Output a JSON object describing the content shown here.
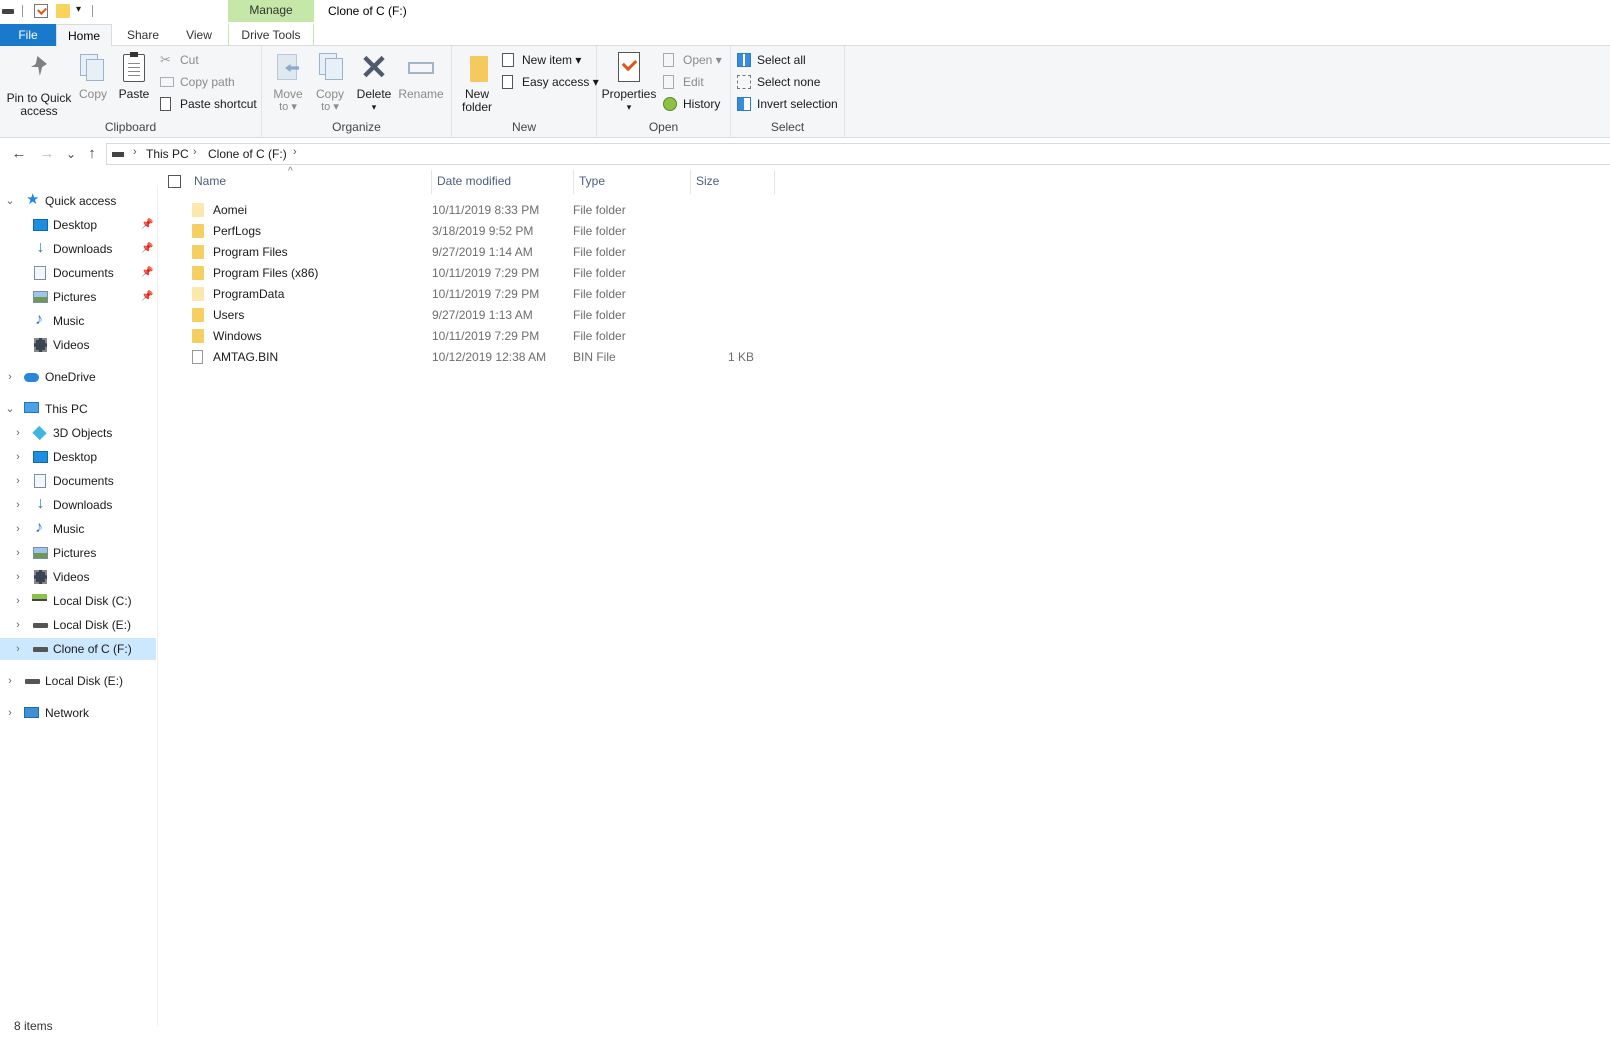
{
  "window": {
    "title": "Clone of C (F:)",
    "context_tab_header": "Manage",
    "qat_dropdown": "▾"
  },
  "tabs": {
    "file": "File",
    "home": "Home",
    "share": "Share",
    "view": "View",
    "drive_tools": "Drive Tools"
  },
  "ribbon": {
    "clipboard": {
      "label": "Clipboard",
      "pin_line1": "Pin to Quick",
      "pin_line2": "access",
      "copy": "Copy",
      "paste": "Paste",
      "cut": "Cut",
      "copy_path": "Copy path",
      "paste_shortcut": "Paste shortcut"
    },
    "organize": {
      "label": "Organize",
      "move_line1": "Move",
      "move_line2": "to ▾",
      "copy_line1": "Copy",
      "copy_line2": "to ▾",
      "delete": "Delete",
      "delete_arrow": "▾",
      "rename": "Rename"
    },
    "new": {
      "label": "New",
      "new_folder_line1": "New",
      "new_folder_line2": "folder",
      "new_item": "New item ▾",
      "easy_access": "Easy access ▾"
    },
    "open": {
      "label": "Open",
      "properties": "Properties",
      "properties_arrow": "▾",
      "open": "Open ▾",
      "edit": "Edit",
      "history": "History"
    },
    "select": {
      "label": "Select",
      "select_all": "Select all",
      "select_none": "Select none",
      "invert_selection": "Invert selection"
    }
  },
  "navigation": {
    "back": "←",
    "forward": "→",
    "recent": "⌄",
    "up": "↑",
    "separator": "›",
    "breadcrumb": [
      "This PC",
      "Clone of C (F:)"
    ]
  },
  "sidebar": {
    "quick_access": "Quick access",
    "quick_items": [
      {
        "label": "Desktop",
        "pinned": true,
        "icon": "desktop-icon"
      },
      {
        "label": "Downloads",
        "pinned": true,
        "icon": "download-icon"
      },
      {
        "label": "Documents",
        "pinned": true,
        "icon": "documents-icon"
      },
      {
        "label": "Pictures",
        "pinned": true,
        "icon": "pictures-icon"
      },
      {
        "label": "Music",
        "pinned": false,
        "icon": "music-icon"
      },
      {
        "label": "Videos",
        "pinned": false,
        "icon": "videos-icon"
      }
    ],
    "onedrive": "OneDrive",
    "this_pc": "This PC",
    "pc_items": [
      {
        "label": "3D Objects",
        "icon": "3d-objects-icon"
      },
      {
        "label": "Desktop",
        "icon": "desktop-icon"
      },
      {
        "label": "Documents",
        "icon": "documents-icon"
      },
      {
        "label": "Downloads",
        "icon": "download-icon"
      },
      {
        "label": "Music",
        "icon": "music-icon"
      },
      {
        "label": "Pictures",
        "icon": "pictures-icon"
      },
      {
        "label": "Videos",
        "icon": "videos-icon"
      },
      {
        "label": "Local Disk (C:)",
        "icon": "system-drive-icon"
      },
      {
        "label": "Local Disk (E:)",
        "icon": "drive-icon"
      },
      {
        "label": "Clone of C (F:)",
        "icon": "drive-icon",
        "selected": true
      }
    ],
    "local_disk_e": "Local Disk (E:)",
    "network": "Network"
  },
  "file_list": {
    "columns": {
      "name": "Name",
      "date_modified": "Date modified",
      "type": "Type",
      "size": "Size"
    },
    "sort_indicator": "^",
    "rows": [
      {
        "name": "Aomei",
        "date": "10/11/2019 8:33 PM",
        "type": "File folder",
        "size": "",
        "kind": "folder-light"
      },
      {
        "name": "PerfLogs",
        "date": "3/18/2019 9:52 PM",
        "type": "File folder",
        "size": "",
        "kind": "folder"
      },
      {
        "name": "Program Files",
        "date": "9/27/2019 1:14 AM",
        "type": "File folder",
        "size": "",
        "kind": "folder"
      },
      {
        "name": "Program Files (x86)",
        "date": "10/11/2019 7:29 PM",
        "type": "File folder",
        "size": "",
        "kind": "folder"
      },
      {
        "name": "ProgramData",
        "date": "10/11/2019 7:29 PM",
        "type": "File folder",
        "size": "",
        "kind": "folder-light"
      },
      {
        "name": "Users",
        "date": "9/27/2019 1:13 AM",
        "type": "File folder",
        "size": "",
        "kind": "folder"
      },
      {
        "name": "Windows",
        "date": "10/11/2019 7:29 PM",
        "type": "File folder",
        "size": "",
        "kind": "folder"
      },
      {
        "name": "AMTAG.BIN",
        "date": "10/12/2019 12:38 AM",
        "type": "BIN File",
        "size": "1 KB",
        "kind": "file"
      }
    ]
  },
  "status_bar": {
    "item_count": "8 items"
  },
  "colors": {
    "file_tab": "#1979ca",
    "context_tab": "#c5e8a8",
    "selection": "#cce8ff",
    "folder": "#f6cf63"
  }
}
